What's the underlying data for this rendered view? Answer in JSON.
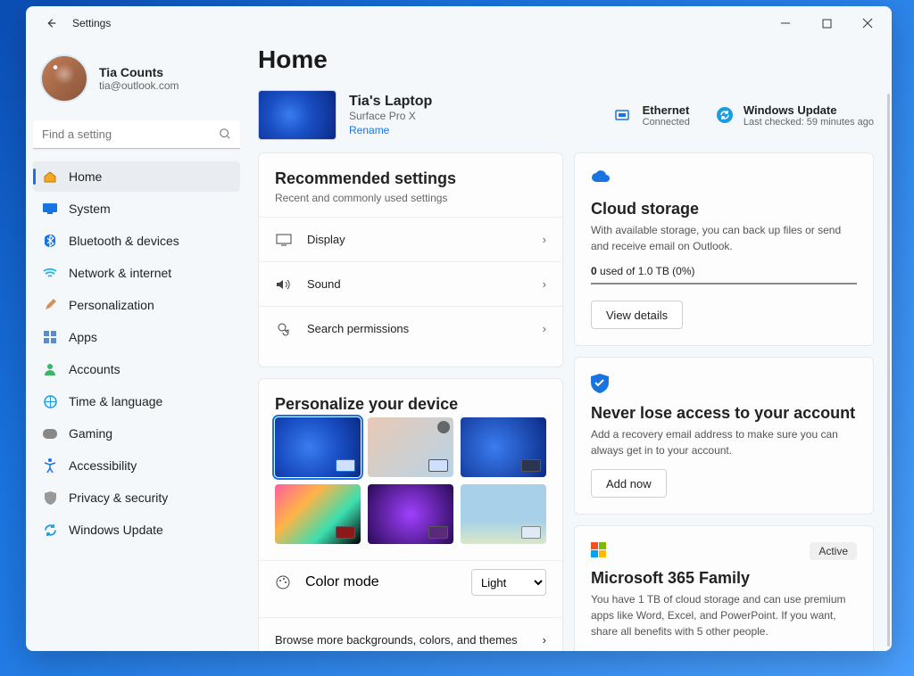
{
  "window": {
    "app_title": "Settings"
  },
  "profile": {
    "name": "Tia Counts",
    "email": "tia@outlook.com"
  },
  "search": {
    "placeholder": "Find a setting"
  },
  "nav": [
    {
      "label": "Home",
      "active": true
    },
    {
      "label": "System"
    },
    {
      "label": "Bluetooth & devices"
    },
    {
      "label": "Network & internet"
    },
    {
      "label": "Personalization"
    },
    {
      "label": "Apps"
    },
    {
      "label": "Accounts"
    },
    {
      "label": "Time & language"
    },
    {
      "label": "Gaming"
    },
    {
      "label": "Accessibility"
    },
    {
      "label": "Privacy & security"
    },
    {
      "label": "Windows Update"
    }
  ],
  "page": {
    "title": "Home"
  },
  "device": {
    "name": "Tia's Laptop",
    "model": "Surface Pro X",
    "rename": "Rename"
  },
  "status": {
    "net": {
      "title": "Ethernet",
      "sub": "Connected"
    },
    "update": {
      "title": "Windows Update",
      "sub": "Last checked: 59 minutes ago"
    }
  },
  "recommended": {
    "title": "Recommended settings",
    "sub": "Recent and commonly used settings",
    "items": [
      "Display",
      "Sound",
      "Search permissions"
    ]
  },
  "personalize": {
    "title": "Personalize your device",
    "color_mode_label": "Color mode",
    "color_mode_value": "Light",
    "browse": "Browse more backgrounds, colors, and themes"
  },
  "cloud": {
    "title": "Cloud storage",
    "body": "With available storage, you can back up files or send and receive email on Outlook.",
    "used_prefix": "0",
    "used_suffix": " used of 1.0 TB (0%)",
    "btn": "View details"
  },
  "recovery": {
    "title": "Never lose access to your account",
    "body": "Add a recovery email address to make sure you can always get in to your account.",
    "btn": "Add now"
  },
  "m365": {
    "title": "Microsoft 365 Family",
    "chip": "Active",
    "body": "You have 1 TB of cloud storage and can use premium apps like Word, Excel, and PowerPoint. If you want, share all benefits with 5 other people."
  }
}
